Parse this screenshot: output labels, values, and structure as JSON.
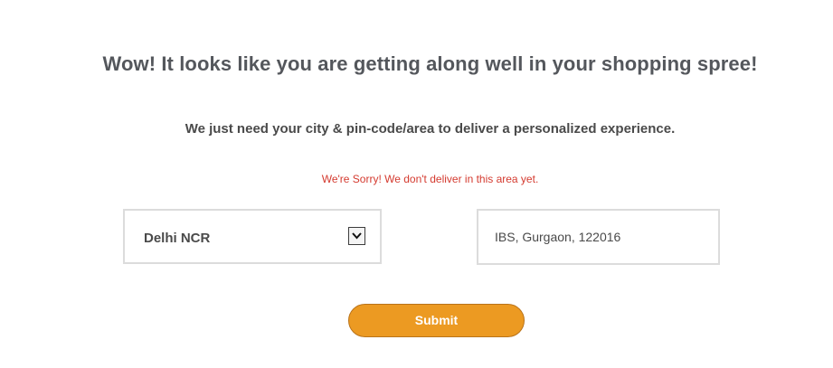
{
  "headline": "Wow! It looks like you are getting along well in your shopping spree!",
  "subline": "We just need your city & pin-code/area to deliver a personalized experience.",
  "error_message": "We're Sorry! We don't deliver in this area yet.",
  "city_select": {
    "selected": "Delhi NCR",
    "icon": "chevron-down-icon"
  },
  "area_input": {
    "value": "IBS, Gurgaon, 122016"
  },
  "submit_label": "Submit",
  "colors": {
    "accent": "#ec9a22",
    "error": "#d43a2f",
    "text": "#54575c",
    "border": "#dcdcdc"
  }
}
